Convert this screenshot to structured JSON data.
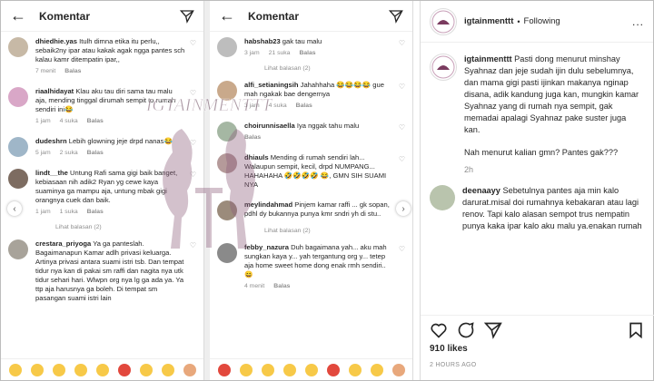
{
  "left_panel": {
    "title": "Komentar",
    "comments": [
      {
        "user": "dhiedhie.yas",
        "text": "Itulh dimna etika itu perlu,, sebaik2ny ipar atau kakak agak ngga pantes sch kalau kamr ditempatin ipar,,",
        "time": "7 menit",
        "likes": "",
        "reply": "Balas",
        "color": "#c7b9a6"
      },
      {
        "user": "riaalhidayat",
        "text": "Klau aku tau diri sama tau malu aja, mending tinggal dirumah sempit to rumah sendiri ini😂",
        "time": "1 jam",
        "likes": "4 suka",
        "reply": "Balas",
        "color": "#d9a7c7"
      },
      {
        "user": "dudeshrn",
        "text": "Lebih glowning jeje drpd nanas😂",
        "time": "5 jam",
        "likes": "2 suka",
        "reply": "Balas",
        "color": "#9fb6c8"
      },
      {
        "user": "lindt__the",
        "text": "Untung Rafi sama gigi baik banget, kebiasaan nih adik2 Ryan yg cewe kaya suaminya ga mampu aja, untung mbak gigi orangnya cuek dan baik.",
        "time": "1 jam",
        "likes": "1 suka",
        "reply": "Balas",
        "color": "#7d6c61"
      },
      {
        "user": "crestara_priyoga",
        "text": "Ya ga panteslah. Bagaimanapun Kamar adlh privasi keluarga. Artinya privasi antara suami istri tsb. Dan tempat tidur nya kan di pakai sm raffi dan nagita nya utk tidur sehari hari. Wlwpn org nya lg ga ada ya. Ya ttp aja harusnya ga boleh. Di tempat sm pasangan suami istri lain",
        "time": "",
        "likes": "",
        "reply": "",
        "color": "#a8a39a"
      }
    ],
    "view_replies": "Lihat balasan (2)"
  },
  "middle_panel": {
    "title": "Komentar",
    "comments": [
      {
        "user": "habshab23",
        "text": "gak tau malu",
        "time": "3 jam",
        "likes": "21 suka",
        "reply": "Balas",
        "color": "#bdbdbd"
      },
      {
        "user": "alfi_setianingsih",
        "text": "Jahahhaha 😂😂😂😂 gue mah ngakak bae dengernya",
        "time": "3 jam",
        "likes": "4 suka",
        "reply": "Balas",
        "color": "#c9a98b"
      },
      {
        "user": "choirunnisaella",
        "text": "Iya nggak tahu malu",
        "time": "",
        "likes": "",
        "reply": "Balas",
        "color": "#a5b7a3"
      },
      {
        "user": "dhiauls",
        "text": "Mending di rumah sendiri lah... Walaupun sempit, kecil, drpd NUMPANG... HAHAHAHA 🤣🤣🤣🤣 😂, GMN SIH SUAMI NYA",
        "time": "",
        "likes": "",
        "reply": "",
        "color": "#b59a9a"
      },
      {
        "user": "meylindahmad",
        "text": "Pinjem kamar raffi ... gk sopan, pdhl dy bukannya punya kmr sndri yh di stu..",
        "time": "",
        "likes": "",
        "reply": "",
        "color": "#9b8b7b"
      },
      {
        "user": "febby_nazura",
        "text": "Duh bagaimana yah... aku mah sungkan kaya y... yah tergantung org y... tetep aja home sweet home dong enak rmh sendiri.. 😄",
        "time": "4 menit",
        "likes": "",
        "reply": "Balas",
        "color": "#8a8a8a"
      }
    ],
    "view_replies": "Lihat balasan (2)",
    "view_replies_2": "Lihat balasan (2)"
  },
  "watermark": "IGTAINMENTTT",
  "right_panel": {
    "username": "igtainmenttt",
    "following": "Following",
    "more": "...",
    "caption_user": "igtainmenttt",
    "caption": "Pasti dong menurut minshay Syahnaz dan jeje sudah ijin dulu sebelumnya, dan mama gigi pasti ijinkan makanya nginap disana, adik kandung juga kan, mungkin kamar Syahnaz yang di rumah nya sempit, gak memadai apalagi Syahnaz pake suster juga kan.",
    "caption_2": "Nah menurut kalian gmn? Pantes gak???",
    "caption_time": "2h",
    "reply_user": "deenaayy",
    "reply_text": "Sebetulnya pantes aja min kalo darurat.misal doi rumahnya kebakaran atau lagi renov. Tapi kalo alasan sempot trus nempatin punya kaka ipar kalo aku malu ya.enakan rumah",
    "likes": "910 likes",
    "time_ago": "2 HOURS AGO"
  }
}
